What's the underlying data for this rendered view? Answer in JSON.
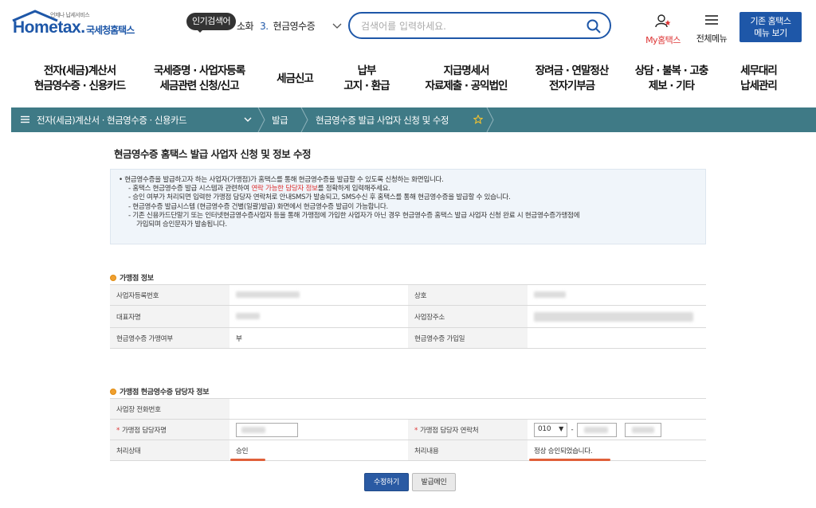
{
  "logo": {
    "tagline": "언제나 납세서비스",
    "main": "Hometax.",
    "sub": "국세청홈택스"
  },
  "popular": {
    "tag": "인기검색어",
    "prefix": "소화",
    "rank": "3.",
    "term": "현금영수증"
  },
  "search": {
    "placeholder": "검색어를 입력하세요."
  },
  "utility": {
    "myhome": "My홈택스",
    "allmenu": "전체메뉴",
    "oldmenu_line1": "기존 홈택스",
    "oldmenu_line2": "메뉴 보기"
  },
  "gnb": [
    {
      "l1": "전자(세금)계산서",
      "l2": "현금영수증 · 신용카드"
    },
    {
      "l1": "국세증명 · 사업자등록",
      "l2": "세금관련 신청/신고"
    },
    {
      "l1": "세금신고",
      "l2": ""
    },
    {
      "l1": "납부",
      "l2": "고지 · 환급"
    },
    {
      "l1": "지급명세서",
      "l2": "자료제출 · 공익법인"
    },
    {
      "l1": "장려금 · 연말정산",
      "l2": "전자기부금"
    },
    {
      "l1": "상담 · 불복 · 고충",
      "l2": "제보 · 기타"
    },
    {
      "l1": "세무대리",
      "l2": "납세관리"
    }
  ],
  "breadcrumb": {
    "c1": "전자(세금)계산서 · 현금영수증 · 신용카드",
    "c2": "발급",
    "c3": "현금영수증 발급 사업자 신청 및 수정"
  },
  "page_title": "현금영수증 홈택스 발급 사업자 신청 및 정보 수정",
  "notice": {
    "n1": "• 현금영수증을 발급하고자 하는 사업자(가맹점)가 홈택스를 통해 현금영수증을 발급할 수 있도록 신청하는 화면입니다.",
    "n2a": "- 홈택스 현금영수증 발급 시스템과 관련하여 ",
    "n2red": "연락 가능한 담당자 정보",
    "n2b": "를 정확하게 입력해주세요.",
    "n3": "- 승인 여부가 처리되면 입력한 가맹점 담당자 연락처로 안내SMS가 발송되고, SMS수신 후 홈택스를 통해 현금영수증을 발급할 수 있습니다.",
    "n4": "- 현금영수증 발급시스템 (현금영수증 건별(일괄)발급) 화면에서 현금영수증 발급이 가능합니다.",
    "n5": "- 기존 신용카드단말기 또는 인터넷현금영수증사업자 등을 통해 가맹점에 가입한 사업자가 아닌 경우 현금영수증 홈택스 발급 사업자 신청 완료 시 현금영수증가맹점에",
    "n6": "가입되며 승인문자가 발송됩니다."
  },
  "section1": {
    "title": "가맹점 정보",
    "biz_no_label": "사업자등록번호",
    "trade_name_label": "상호",
    "rep_label": "대표자명",
    "addr_label": "사업장주소",
    "joined_label": "현금영수증 가맹여부",
    "joined_value": "부",
    "join_date_label": "현금영수증 가입일"
  },
  "section2": {
    "title": "가맹점 현금영수증 담당자 정보",
    "phone_label": "사업장 전화번호",
    "manager_label": "가맹점 담당자명",
    "manager_contact_label": "가맹점 담당자 연락처",
    "phone_prefix": "010",
    "phone_dash": "-",
    "status_label": "처리상태",
    "status_value": "승인",
    "result_label": "처리내용",
    "result_value": "정상 승인되었습니다."
  },
  "buttons": {
    "save": "수정하기",
    "guide": "발급메인"
  },
  "colors": {
    "brand": "#1e57a8",
    "crumb": "#3f7a86",
    "highlight": "#e0603a"
  }
}
